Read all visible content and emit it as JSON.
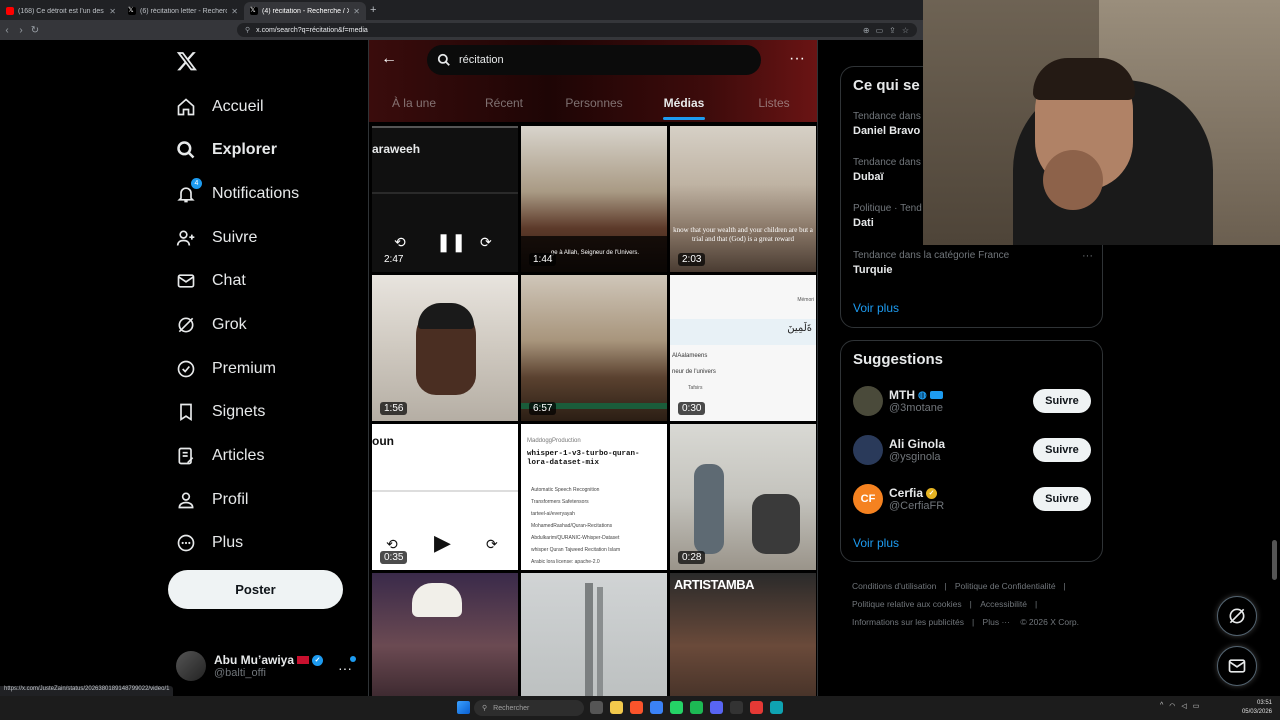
{
  "browser": {
    "tabs": [
      {
        "title": "(168) Ce détroit est l'un des enjeux n",
        "icon_color": "#ff0000"
      },
      {
        "title": "(6) récitation letter - Recherche / X",
        "icon_color": "#ffffff"
      },
      {
        "title": "(4) récitation - Recherche / X",
        "icon_color": "#ffffff"
      }
    ],
    "url": "x.com/search?q=récitation&f=media",
    "status_url": "https://x.com/JusteZain/status/2026380189148799022/video/1"
  },
  "nav": {
    "items": [
      {
        "label": "Accueil",
        "icon": "home-icon"
      },
      {
        "label": "Explorer",
        "icon": "search-icon"
      },
      {
        "label": "Notifications",
        "icon": "bell-icon",
        "badge": "4"
      },
      {
        "label": "Suivre",
        "icon": "add-person-icon"
      },
      {
        "label": "Chat",
        "icon": "mail-icon"
      },
      {
        "label": "Grok",
        "icon": "grok-icon"
      },
      {
        "label": "Premium",
        "icon": "premium-icon"
      },
      {
        "label": "Signets",
        "icon": "bookmark-icon"
      },
      {
        "label": "Articles",
        "icon": "article-icon"
      },
      {
        "label": "Profil",
        "icon": "person-icon"
      },
      {
        "label": "Plus",
        "icon": "more-circle-icon"
      }
    ],
    "post_label": "Poster",
    "account": {
      "display_name": "Abu Mu’awiya",
      "handle": "@balti_offi"
    }
  },
  "search": {
    "query": "récitation"
  },
  "center_tabs": [
    {
      "label": "À la une",
      "active": false
    },
    {
      "label": "Récent",
      "active": false
    },
    {
      "label": "Personnes",
      "active": false
    },
    {
      "label": "Médias",
      "active": true
    },
    {
      "label": "Listes",
      "active": false
    }
  ],
  "media": [
    {
      "duration": "2:47",
      "overlay_text": "araweeh"
    },
    {
      "duration": "1:44",
      "caption": "ge à Allah, Seigneur de l'Univers."
    },
    {
      "duration": "2:03",
      "caption": "know that your wealth and your children are but a trial and that (God) is a great reward"
    },
    {
      "duration": "1:56"
    },
    {
      "duration": "6:57"
    },
    {
      "duration": "0:30",
      "snippet_lines": [
        "Mémori",
        "ةَلَمِينَ",
        "AlAalameens",
        "neur de l'univers",
        "Tafsirs"
      ]
    },
    {
      "duration": "0:35",
      "overlay_text": "oun"
    },
    {
      "duration": "",
      "card": {
        "org": "MaddoggProduction",
        "title": "whisper-1-v3-turbo-quran-lora-dataset-mix",
        "lines": [
          "Automatic Speech Recognition",
          "Transformers  Safetensors",
          "tarteel-ai/everyayah",
          "MohamedRashad/Quran-Recitations",
          "Abdulkarim/QURANIC-Whisper-Dataset",
          "whisper  Quran  Tajweed  Recitation  Islam",
          "Arabic  lora  license: apache-2.0"
        ]
      }
    },
    {
      "duration": "0:28"
    },
    {
      "duration": ""
    },
    {
      "duration": ""
    },
    {
      "duration": "",
      "overlay_text": "ARTISTAMBA"
    }
  ],
  "trends": {
    "title": "Ce qui se",
    "items": [
      {
        "meta": "Tendance dans",
        "name": "Daniel Bravo"
      },
      {
        "meta": "Tendance dans",
        "name": "Dubaï"
      },
      {
        "meta": "Politique · Tend",
        "name": "Dati"
      },
      {
        "meta": "Tendance dans la catégorie France",
        "name": "Turquie"
      }
    ],
    "more": "Voir plus"
  },
  "suggestions": {
    "title": "Suggestions",
    "items": [
      {
        "name": "MTH",
        "handle": "@3motane",
        "button": "Suivre",
        "avatar_color": "#4a4a3a"
      },
      {
        "name": "Ali Ginola",
        "handle": "@ysginola",
        "button": "Suivre",
        "avatar_color": "#2a3a5a"
      },
      {
        "name": "Cerfia",
        "handle": "@CerfiaFR",
        "button": "Suivre",
        "avatar_color": "#f58220"
      }
    ],
    "more": "Voir plus"
  },
  "footer": {
    "links": [
      "Conditions d'utilisation",
      "Politique de Confidentialité",
      "Politique relative aux cookies",
      "Accessibilité",
      "Informations sur les publicités",
      "Plus ···",
      "© 2026 X Corp."
    ]
  },
  "taskbar": {
    "search_placeholder": "Rechercher",
    "time": "03:51",
    "date": "05/03/2026"
  },
  "colors": {
    "accent": "#1d9bf0",
    "header_red": "#6b1414"
  }
}
